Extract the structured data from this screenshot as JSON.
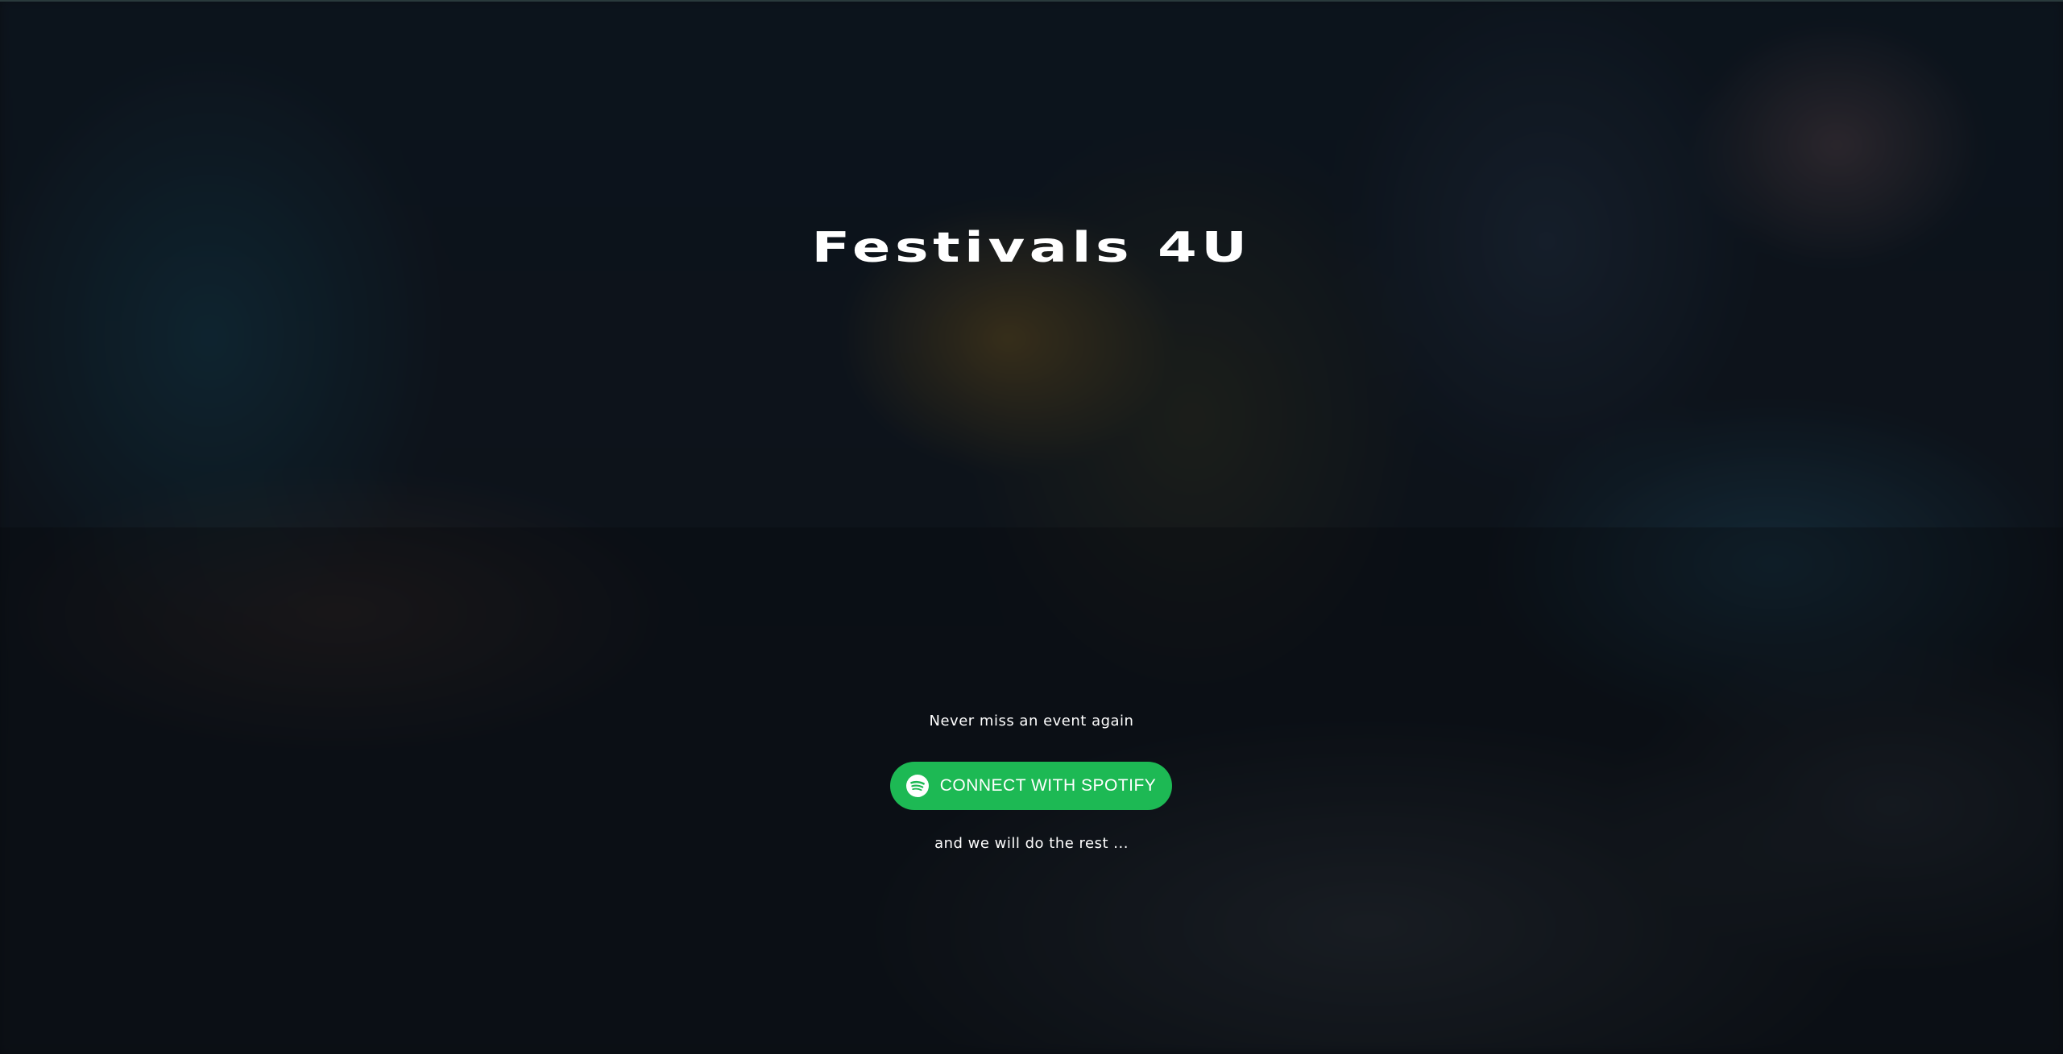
{
  "hero": {
    "title": "Festivals 4U",
    "tagline": "Never miss an event again",
    "subline": "and we will do the rest ...",
    "background_image": "blurred-concert-crowd-photo"
  },
  "connect_button": {
    "label": "CONNECT WITH SPOTIFY",
    "icon": "spotify-icon",
    "color": "#1db954",
    "text_color": "#ffffff"
  }
}
